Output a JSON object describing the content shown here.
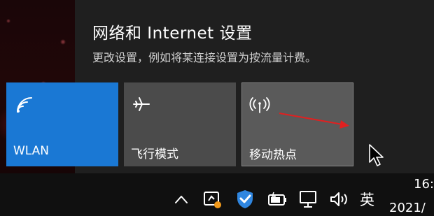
{
  "panel": {
    "title": "网络和 Internet 设置",
    "subtitle": "更改设置，例如将某连接设置为按流量计费。"
  },
  "quick_actions": [
    {
      "label": "WLAN",
      "icon": "wifi-icon",
      "active": true,
      "color": "#1a78d4"
    },
    {
      "label": "飞行模式",
      "icon": "airplane-icon",
      "active": false,
      "color": "#4b4b4b"
    },
    {
      "label": "移动热点",
      "icon": "hotspot-icon",
      "active": false,
      "color": "#5a5a5a"
    }
  ],
  "annotation": {
    "icon": "red-arrow",
    "color": "#e02020"
  },
  "taskbar": {
    "tray_icons": [
      "chevron-up-icon",
      "monitor-badge-icon",
      "shield-icon",
      "battery-icon",
      "network-icon",
      "volume-icon"
    ],
    "input_language": "英",
    "clock_time": "16:",
    "clock_date": "2021/"
  }
}
